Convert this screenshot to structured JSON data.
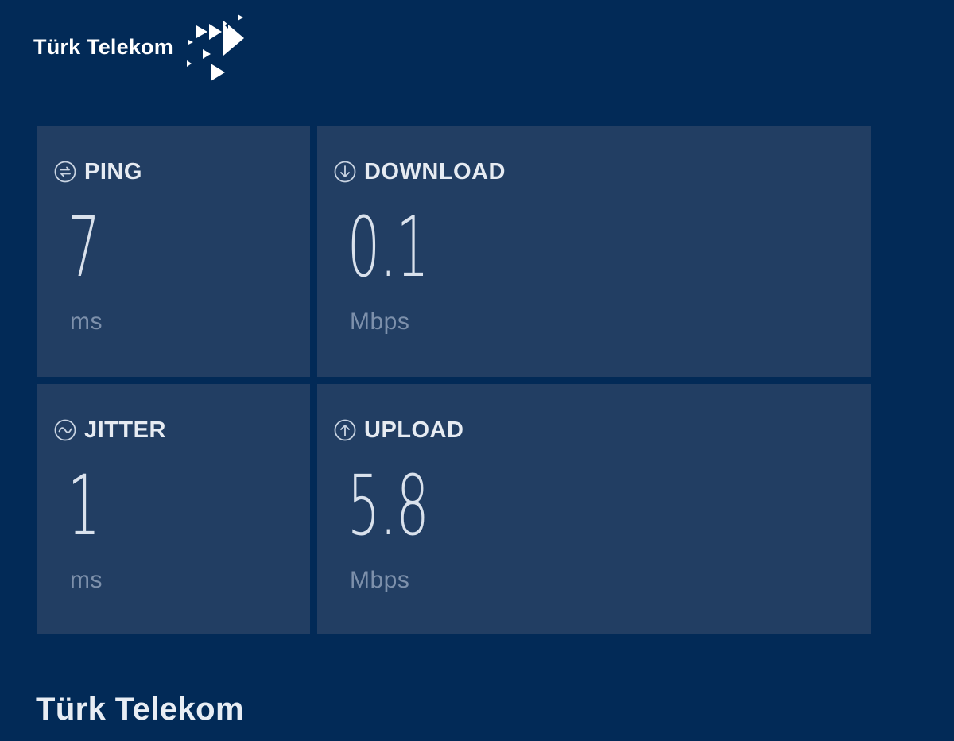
{
  "brand": {
    "logo_text": "Türk Telekom",
    "icon": "turk-telekom-arrows-logo",
    "background_color": "#022a57",
    "tile_color": "#223e63"
  },
  "metrics": {
    "ping": {
      "label": "PING",
      "value": "7",
      "unit": "ms",
      "icon": "ping-icon"
    },
    "download": {
      "label": "DOWNLOAD",
      "value": "0.1",
      "unit": "Mbps",
      "icon": "download-arrow-icon"
    },
    "jitter": {
      "label": "JITTER",
      "value": "1",
      "unit": "ms",
      "icon": "jitter-wave-icon"
    },
    "upload": {
      "label": "UPLOAD",
      "value": "5.8",
      "unit": "Mbps",
      "icon": "upload-arrow-icon"
    }
  },
  "provider": {
    "name": "Türk Telekom"
  }
}
